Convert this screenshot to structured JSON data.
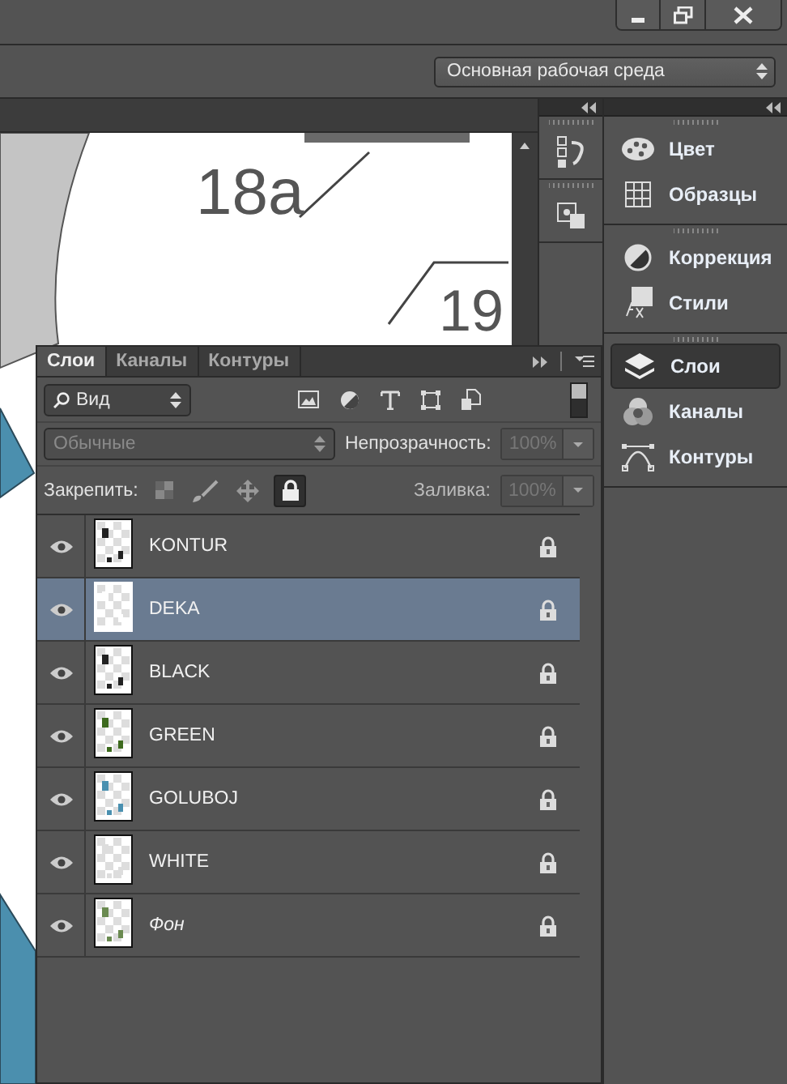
{
  "workspace": {
    "value": "Основная рабочая среда"
  },
  "canvas": {
    "labels": [
      "18a",
      "19"
    ]
  },
  "dock": {
    "groups": [
      [
        {
          "label": "Цвет",
          "kind": "color",
          "selected": false
        },
        {
          "label": "Образцы",
          "kind": "swatches",
          "selected": false
        }
      ],
      [
        {
          "label": "Коррекция",
          "kind": "adjust",
          "selected": false
        },
        {
          "label": "Стили",
          "kind": "styles",
          "selected": false
        }
      ],
      [
        {
          "label": "Слои",
          "kind": "layers",
          "selected": true
        },
        {
          "label": "Каналы",
          "kind": "channels",
          "selected": false
        },
        {
          "label": "Контуры",
          "kind": "paths",
          "selected": false
        }
      ]
    ]
  },
  "layers_panel": {
    "tabs": [
      {
        "label": "Слои",
        "selected": true
      },
      {
        "label": "Каналы",
        "selected": false
      },
      {
        "label": "Контуры",
        "selected": false
      }
    ],
    "filter": {
      "value": "Вид"
    },
    "blend_mode": {
      "value": "Обычные",
      "disabled": true
    },
    "opacity": {
      "label": "Непрозрачность:",
      "value": "100%",
      "disabled": true
    },
    "lock": {
      "label": "Закрепить:",
      "options": [
        {
          "kind": "transparency",
          "on": false
        },
        {
          "kind": "paint",
          "on": false
        },
        {
          "kind": "move",
          "on": false
        },
        {
          "kind": "all",
          "on": true
        }
      ]
    },
    "fill": {
      "label": "Заливка:",
      "value": "100%",
      "disabled": true
    },
    "layers": [
      {
        "name": "KONTUR",
        "kind": "layer",
        "visible": true,
        "locked": true,
        "selected": false
      },
      {
        "name": "DEKA",
        "kind": "layer",
        "visible": true,
        "locked": true,
        "selected": true
      },
      {
        "name": "BLACK",
        "kind": "layer",
        "visible": true,
        "locked": true,
        "selected": false
      },
      {
        "name": "GREEN",
        "kind": "layer",
        "visible": true,
        "locked": true,
        "selected": false
      },
      {
        "name": "GOLUBOJ",
        "kind": "layer",
        "visible": true,
        "locked": true,
        "selected": false
      },
      {
        "name": "WHITE",
        "kind": "layer",
        "visible": true,
        "locked": true,
        "selected": false
      },
      {
        "name": "Фон",
        "kind": "background",
        "visible": true,
        "locked": true,
        "selected": false
      }
    ]
  }
}
